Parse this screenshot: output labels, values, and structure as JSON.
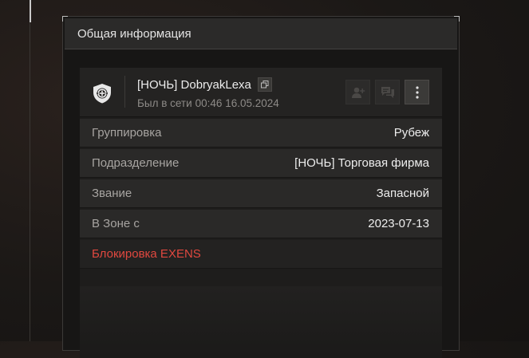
{
  "panel": {
    "title": "Общая информация"
  },
  "profile": {
    "name": "[НОЧЬ] DobryakLexa",
    "last_seen_label": "Был в сети",
    "last_seen_time": "00:46 16.05.2024"
  },
  "icons": {
    "emblem": "shield-crosshair-icon",
    "copy": "copy-icon",
    "add_friend": "add-friend-icon",
    "message": "message-icon",
    "more": "more-vertical-icon"
  },
  "info": {
    "group": {
      "label": "Группировка",
      "value": "Рубеж"
    },
    "division": {
      "label": "Подразделение",
      "value": "[НОЧЬ] Торговая фирма"
    },
    "rank": {
      "label": "Звание",
      "value": "Запасной"
    },
    "zone_since": {
      "label": "В Зоне с",
      "value": "2023-07-13"
    },
    "block": {
      "label": "Блокировка EXENS"
    }
  },
  "colors": {
    "block_text": "#e0483f",
    "header_bg": "#2b2a29",
    "row_bg": "#2a2928"
  }
}
